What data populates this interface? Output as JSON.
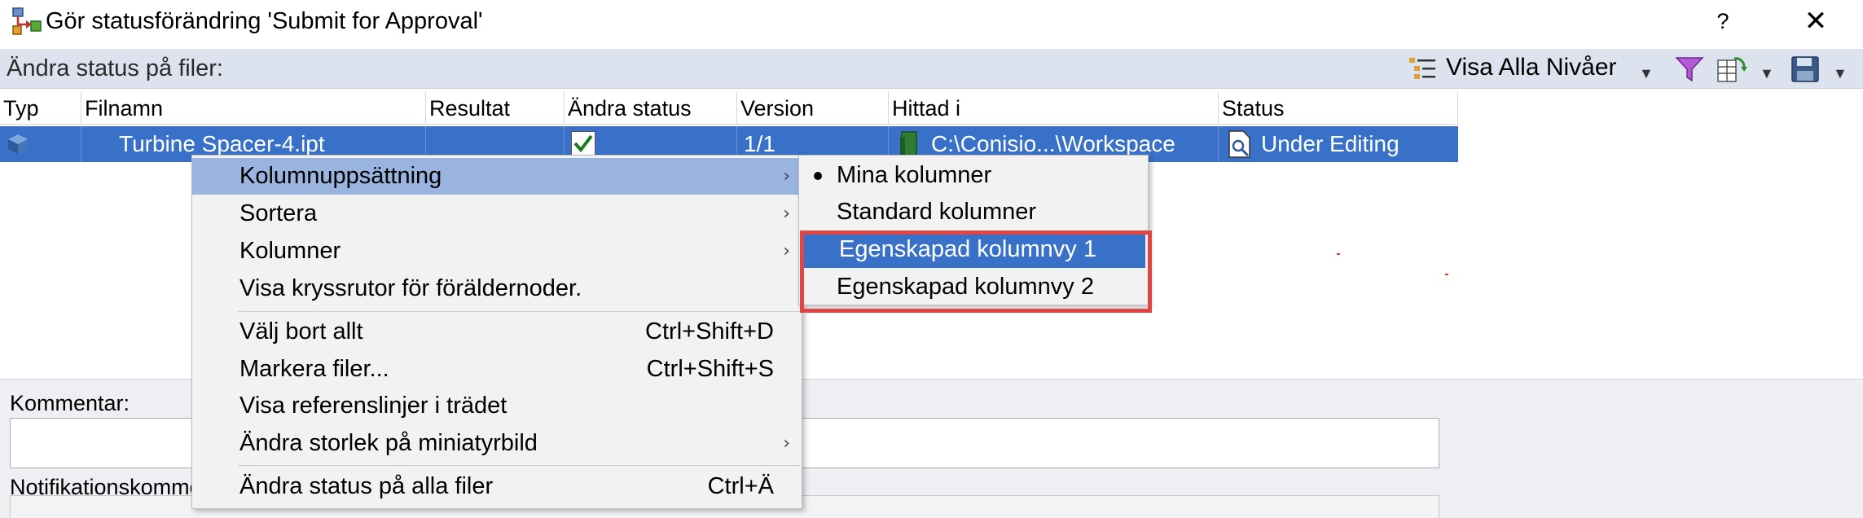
{
  "window": {
    "title": "Gör statusförändring 'Submit for Approval'",
    "help_label": "?",
    "close_label": "✕"
  },
  "toolbar": {
    "label": "Ändra status på filer:",
    "levels_label": "Visa Alla Nivåer",
    "caret": "▼"
  },
  "grid": {
    "columns": [
      "Typ",
      "Filnamn",
      "Resultat",
      "Ändra status",
      "Version",
      "Hittad i",
      "Status"
    ],
    "row": {
      "filename": "Turbine Spacer-4.ipt",
      "version": "1/1",
      "found_in": "C:\\Conisio...\\Workspace",
      "status": "Under Editing"
    }
  },
  "context_menu": {
    "items": [
      {
        "label": "Kolumnuppsättning",
        "submenu_arrow": "›"
      },
      {
        "label": "Sortera",
        "submenu_arrow": "›"
      },
      {
        "label": "Kolumner",
        "submenu_arrow": "›"
      },
      {
        "label": "Visa kryssrutor för föräldernoder."
      },
      {
        "label": "Välj bort allt",
        "shortcut": "Ctrl+Shift+D"
      },
      {
        "label": "Markera filer...",
        "shortcut": "Ctrl+Shift+S"
      },
      {
        "label": "Visa referenslinjer i trädet"
      },
      {
        "label": "Ändra storlek på miniatyrbild",
        "submenu_arrow": "›"
      },
      {
        "label": "Ändra status på alla filer",
        "shortcut": "Ctrl+Ä"
      }
    ]
  },
  "submenu": {
    "items": [
      {
        "label": "Mina kolumner"
      },
      {
        "label": "Standard kolumner"
      },
      {
        "label": "Egenskapad kolumnvy 1"
      },
      {
        "label": "Egenskapad kolumnvy 2"
      }
    ]
  },
  "lower": {
    "comment_label": "Kommentar:",
    "notification_label": "Notifikationskommentar:"
  },
  "colors": {
    "selection": "#3a71c8",
    "menu_highlight": "#99b4df",
    "toolbar_bg": "#dde3ee",
    "annotation_red": "#e04545"
  }
}
